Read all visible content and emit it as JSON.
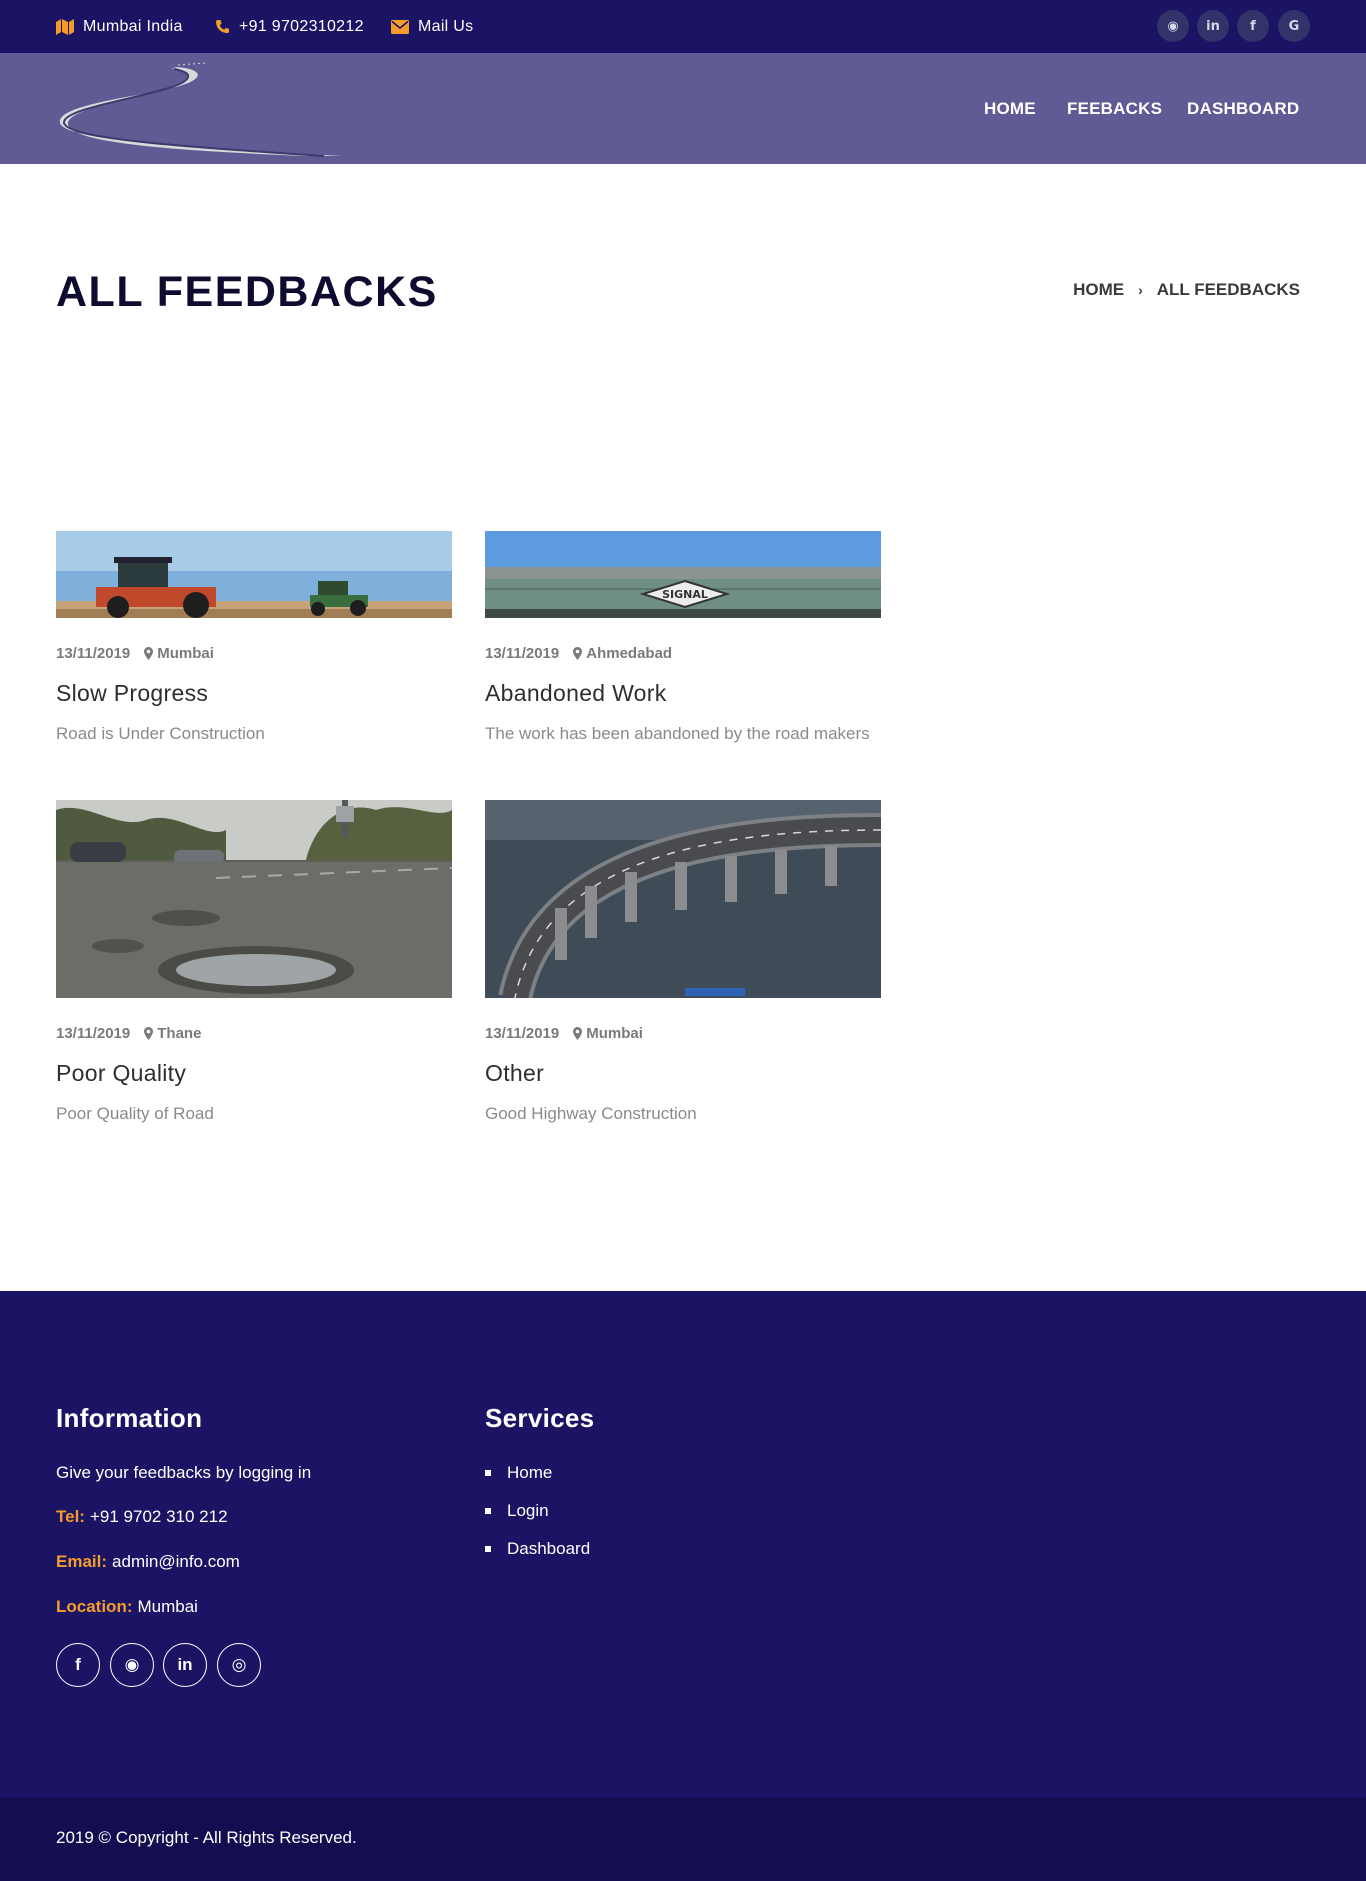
{
  "topbar": {
    "location": "Mumbai India",
    "phone": "+91 9702310212",
    "mail": "Mail Us",
    "social": [
      {
        "name": "github-icon",
        "glyph": "◉"
      },
      {
        "name": "linkedin-icon",
        "glyph": "in"
      },
      {
        "name": "facebook-icon",
        "glyph": "f"
      },
      {
        "name": "google-icon",
        "glyph": "G"
      }
    ]
  },
  "nav": {
    "home": "HOME",
    "feedbacks": "FEEBACKS",
    "dashboard": "DASHBOARD"
  },
  "header": {
    "title": "ALL FEEDBACKS",
    "breadcrumb_home": "HOME",
    "breadcrumb_sep": "›",
    "breadcrumb_current": "ALL FEEDBACKS"
  },
  "feedbacks": [
    {
      "date": "13/11/2019",
      "location": "Mumbai",
      "title": "Slow Progress",
      "description": "Road is Under Construction",
      "image": "tractors-on-field"
    },
    {
      "date": "13/11/2019",
      "location": "Ahmedabad",
      "title": "Abandoned Work",
      "description": "The work has been abandoned by the road makers",
      "image": "overpass-signal-sign"
    },
    {
      "date": "13/11/2019",
      "location": "Thane",
      "title": "Poor Quality",
      "description": "Poor Quality of Road",
      "image": "potholed-road"
    },
    {
      "date": "13/11/2019",
      "location": "Mumbai",
      "title": "Other",
      "description": "Good Highway Construction",
      "image": "curved-sea-bridge"
    }
  ],
  "footer": {
    "information_heading": "Information",
    "info_text": "Give your feedbacks by logging in",
    "tel_label": "Tel:",
    "tel_value": "+91 9702 310 212",
    "email_label": "Email:",
    "email_value": "admin@info.com",
    "location_label": "Location:",
    "location_value": "Mumbai",
    "services_heading": "Services",
    "services": [
      "Home",
      "Login",
      "Dashboard"
    ],
    "social": [
      {
        "name": "facebook-icon",
        "glyph": "f"
      },
      {
        "name": "github-icon",
        "glyph": "◉"
      },
      {
        "name": "linkedin-icon",
        "glyph": "in"
      },
      {
        "name": "instagram-icon",
        "glyph": "◎"
      }
    ],
    "copyright": "2019 © Copyright - All Rights Reserved."
  },
  "colors": {
    "topbar": "#1b1464",
    "navbar": "#605a95",
    "accent": "#f39c2b",
    "footer": "#1b1464"
  }
}
